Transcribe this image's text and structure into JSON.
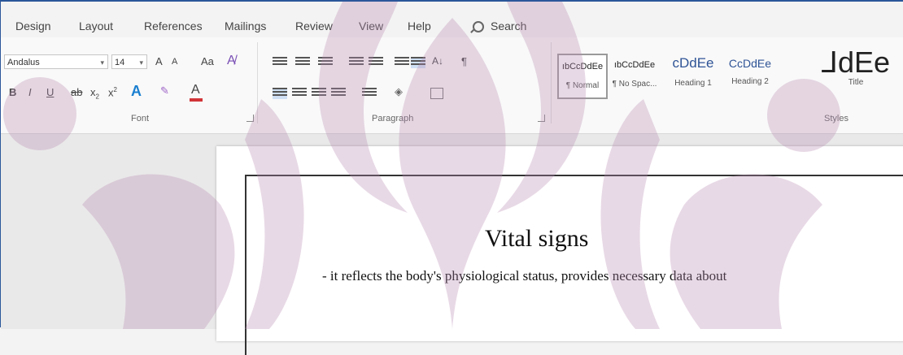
{
  "ribbon_tabs": [
    "Design",
    "Layout",
    "References",
    "Mailings",
    "Review",
    "View",
    "Help"
  ],
  "search": {
    "label": "Search",
    "icon": "search-icon"
  },
  "font": {
    "name": "Andalus",
    "size": "14",
    "grow": "A",
    "shrink": "A",
    "change_case": "Aa",
    "bold": "B",
    "italic": "I",
    "underline": "U",
    "strike": "ab",
    "subscript": "x",
    "superscript": "x",
    "text_effects": "A",
    "font_color": "A",
    "group_label": "Font"
  },
  "paragraph": {
    "sort": "A↓",
    "pilcrow": "¶",
    "group_label": "Paragraph"
  },
  "styles": {
    "items": [
      {
        "sample": "ıbCcDdEe",
        "name": "¶ Normal"
      },
      {
        "sample": "ıbCcDdEe",
        "name": "¶ No Spac..."
      },
      {
        "sample": "cDdEe",
        "name": "Heading 1"
      },
      {
        "sample": "CcDdEe",
        "name": "Heading 2"
      },
      {
        "sample": "⅃dEe",
        "name": "Title"
      }
    ],
    "group_label": "Styles"
  },
  "document": {
    "title": "Vital signs",
    "line1": "- it reflects the body's physiological status, provides necessary data about"
  },
  "colors": {
    "accent": "#2b579a",
    "watermark": "#b98ab2",
    "font_color_bar": "#d13438"
  }
}
